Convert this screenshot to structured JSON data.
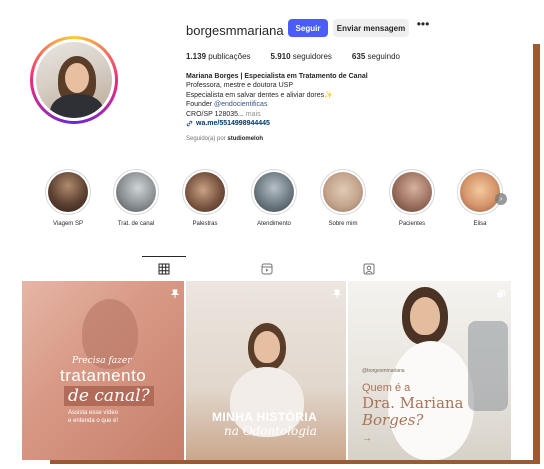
{
  "profile": {
    "username": "borgesmmariana",
    "verified": true,
    "follow_label": "Seguir",
    "message_label": "Enviar mensagem",
    "more_label": "•••"
  },
  "stats": {
    "posts_value": "1.139",
    "posts_label": "publicações",
    "followers_value": "5.910",
    "followers_label": "seguidores",
    "following_value": "635",
    "following_label": "seguindo"
  },
  "bio": {
    "name": "Mariana Borges | Especialista em Tratamento de Canal",
    "line1": "Professora, mestre e doutora USP",
    "line2": "Especialista em salvar dentes e aliviar dores✨",
    "line3_prefix": "Founder ",
    "line3_link": "@endocientificas",
    "line4": "CRO/SP 128035...",
    "line4_more": " mais",
    "website": "wa.me/5514998944445",
    "followed_prefix": "Seguido(a) por ",
    "followed_by": "studiomeloh"
  },
  "highlights": [
    {
      "label": "Viagem SP"
    },
    {
      "label": "Trat. de canal"
    },
    {
      "label": "Palestras"
    },
    {
      "label": "Atendimento"
    },
    {
      "label": "Sobre mim"
    },
    {
      "label": "Pacientes"
    },
    {
      "label": "Elisa"
    }
  ],
  "highlights_next": "›",
  "tabs": [
    {
      "icon": "grid-icon",
      "active": true
    },
    {
      "icon": "reels-icon",
      "active": false
    },
    {
      "icon": "tagged-icon",
      "active": false
    }
  ],
  "posts": {
    "p1": {
      "line1": "Precisa fazer",
      "line2": "tratamento",
      "line3": "de canal?",
      "sub1": "Assista esse vídeo",
      "sub2": "e entenda o que é!"
    },
    "p2": {
      "line1": "MINHA HISTÓRIA",
      "line2": "na Odontologia"
    },
    "p3": {
      "handle": "@borgesmmariana",
      "line1": "Quem é a",
      "line2": "Dra. Mariana",
      "line3": "Borges?",
      "arrow": "→"
    }
  },
  "colors": {
    "follow_button": "#4a5df9",
    "verified_badge": "#3797f0",
    "frame": "#9a5a32",
    "accent_text": "#a87559"
  }
}
